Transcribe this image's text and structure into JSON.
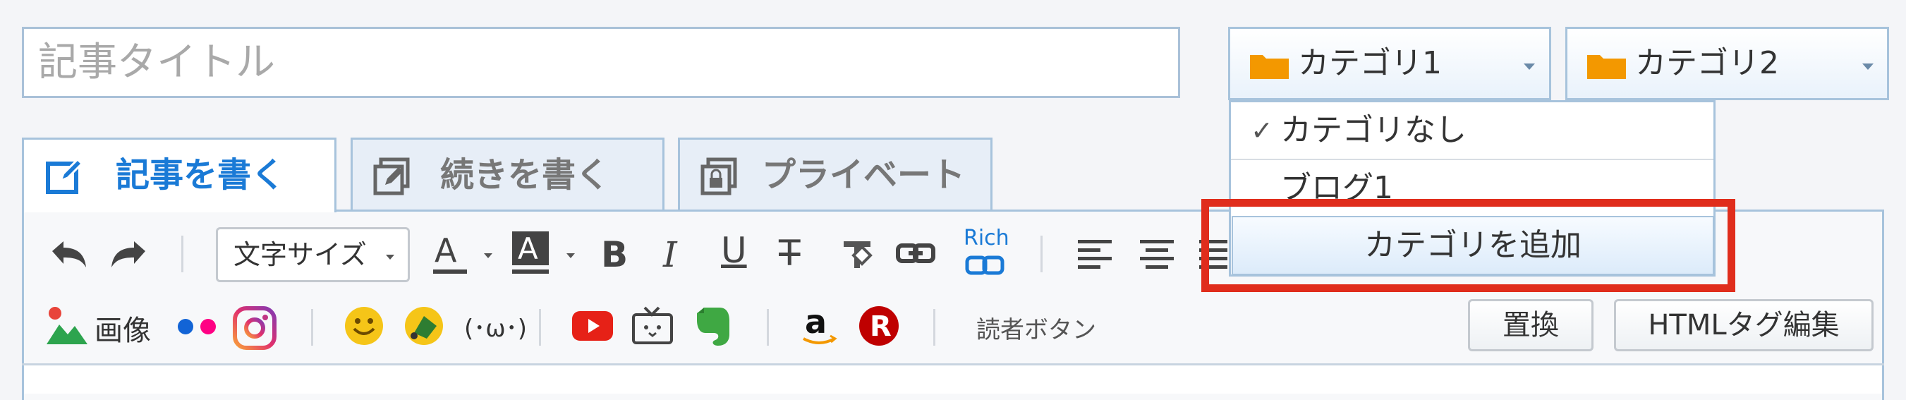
{
  "title_field": {
    "placeholder": "記事タイトル",
    "value": ""
  },
  "categories": {
    "select1_label": "カテゴリ1",
    "select2_label": "カテゴリ2",
    "dropdown": {
      "items": [
        {
          "label": "カテゴリなし",
          "checked": true,
          "check_mark": "✓"
        },
        {
          "label": "ブログ1",
          "checked": false
        }
      ],
      "add_label": "カテゴリを追加"
    }
  },
  "tabs": [
    {
      "label": "記事を書く",
      "active": true
    },
    {
      "label": "続きを書く",
      "active": false
    },
    {
      "label": "プライベート",
      "active": false
    }
  ],
  "toolbar": {
    "font_size_label": "文字サイズ",
    "rich_link_label": "Rich",
    "image_label": "画像",
    "emoticon_label": "(･ω･)",
    "reader_button_label": "読者ボタン",
    "replace_label": "置換",
    "html_edit_label": "HTMLタグ編集"
  },
  "colors": {
    "accent": "#1a7ad6",
    "folder": "#f39800",
    "highlight": "#e02d1c",
    "border": "#a7c3dc"
  }
}
